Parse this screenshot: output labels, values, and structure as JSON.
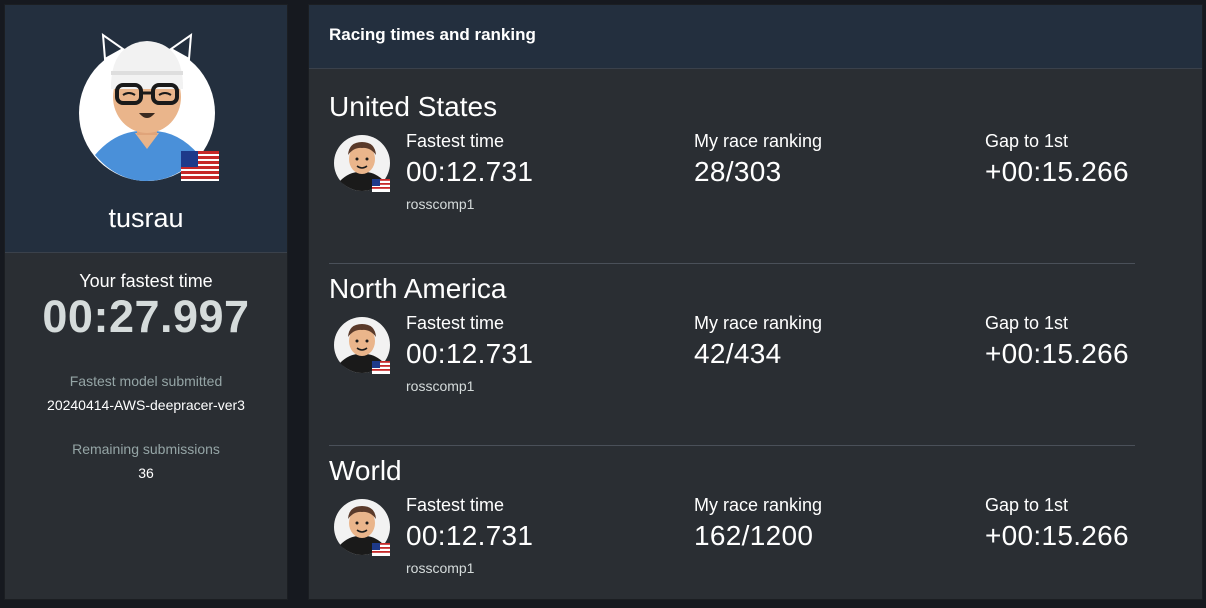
{
  "profile": {
    "username": "tusrau",
    "fastest_label": "Your fastest time",
    "fastest_value": "00:27.997",
    "model_label": "Fastest model submitted",
    "model_value": "20240414-AWS-deepracer-ver3",
    "remaining_label": "Remaining submissions",
    "remaining_value": "36",
    "avatar_icon": "racer-avatar-icon",
    "flag_icon": "us-flag-icon"
  },
  "main": {
    "title": "Racing times and ranking",
    "sections": [
      {
        "region": "United States",
        "fastest_label": "Fastest time",
        "fastest_value": "00:12.731",
        "racer": "rosscomp1",
        "ranking_label": "My race ranking",
        "ranking_value": "28/303",
        "gap_label": "Gap to 1st",
        "gap_value": "+00:15.266"
      },
      {
        "region": "North America",
        "fastest_label": "Fastest time",
        "fastest_value": "00:12.731",
        "racer": "rosscomp1",
        "ranking_label": "My race ranking",
        "ranking_value": "42/434",
        "gap_label": "Gap to 1st",
        "gap_value": "+00:15.266"
      },
      {
        "region": "World",
        "fastest_label": "Fastest time",
        "fastest_value": "00:12.731",
        "racer": "rosscomp1",
        "ranking_label": "My race ranking",
        "ranking_value": "162/1200",
        "gap_label": "Gap to 1st",
        "gap_value": "+00:15.266"
      }
    ]
  },
  "colors": {
    "background": "#16191f",
    "panel": "#2a2e33",
    "header": "#232f3e",
    "text": "#ffffff",
    "muted": "#95a5a6"
  }
}
